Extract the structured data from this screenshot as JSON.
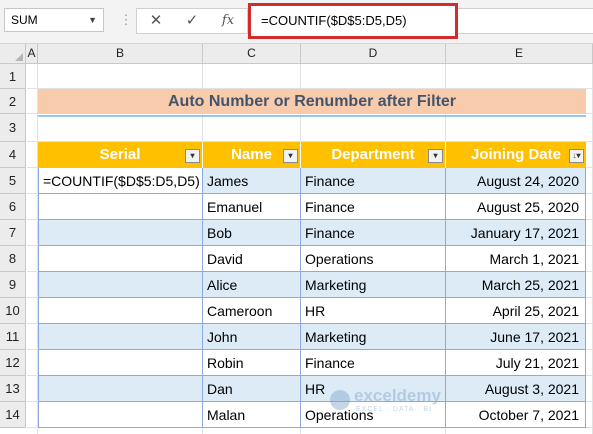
{
  "namebox": {
    "value": "SUM"
  },
  "formula_bar": {
    "separator": "⋮",
    "cancel_symbol": "✕",
    "enter_symbol": "✓",
    "fx_symbol": "fx",
    "formula": "=COUNTIF($D$5:D5,D5)"
  },
  "columns": [
    "A",
    "B",
    "C",
    "D",
    "E"
  ],
  "rows": [
    "1",
    "2",
    "3",
    "4",
    "5",
    "6",
    "7",
    "8",
    "9",
    "10",
    "11",
    "12",
    "13",
    "14"
  ],
  "title": "Auto Number or Renumber after Filter",
  "table": {
    "headers": [
      "Serial",
      "Name",
      "Department",
      "Joining Date"
    ],
    "filter_icon": "▾",
    "sorted_filter_icon": "↓▾",
    "formula_cell": "=COUNTIF($D$5:D5,D5)",
    "rows": [
      {
        "serial": "",
        "name": "James",
        "dept": "Finance",
        "date": "August 24, 2020"
      },
      {
        "serial": "",
        "name": "Emanuel",
        "dept": "Finance",
        "date": "August 25, 2020"
      },
      {
        "serial": "",
        "name": "Bob",
        "dept": "Finance",
        "date": "January 17, 2021"
      },
      {
        "serial": "",
        "name": "David",
        "dept": "Operations",
        "date": "March 1, 2021"
      },
      {
        "serial": "",
        "name": "Alice",
        "dept": "Marketing",
        "date": "March 25, 2021"
      },
      {
        "serial": "",
        "name": "Cameroon",
        "dept": "HR",
        "date": "April 25, 2021"
      },
      {
        "serial": "",
        "name": "John",
        "dept": "Marketing",
        "date": "June 17, 2021"
      },
      {
        "serial": "",
        "name": "Robin",
        "dept": "Finance",
        "date": "July 21, 2021"
      },
      {
        "serial": "",
        "name": "Dan",
        "dept": "HR",
        "date": "August 3, 2021"
      },
      {
        "serial": "",
        "name": "Malan",
        "dept": "Operations",
        "date": "October 7, 2021"
      }
    ]
  },
  "watermark": {
    "name": "exceldemy",
    "tagline": "EXCEL · DATA · BI"
  },
  "colors": {
    "header": "#ffc000",
    "band": "#ddebf7",
    "title_bg": "#f8cbad",
    "title_text": "#44546a",
    "highlight": "#d22c2c"
  }
}
